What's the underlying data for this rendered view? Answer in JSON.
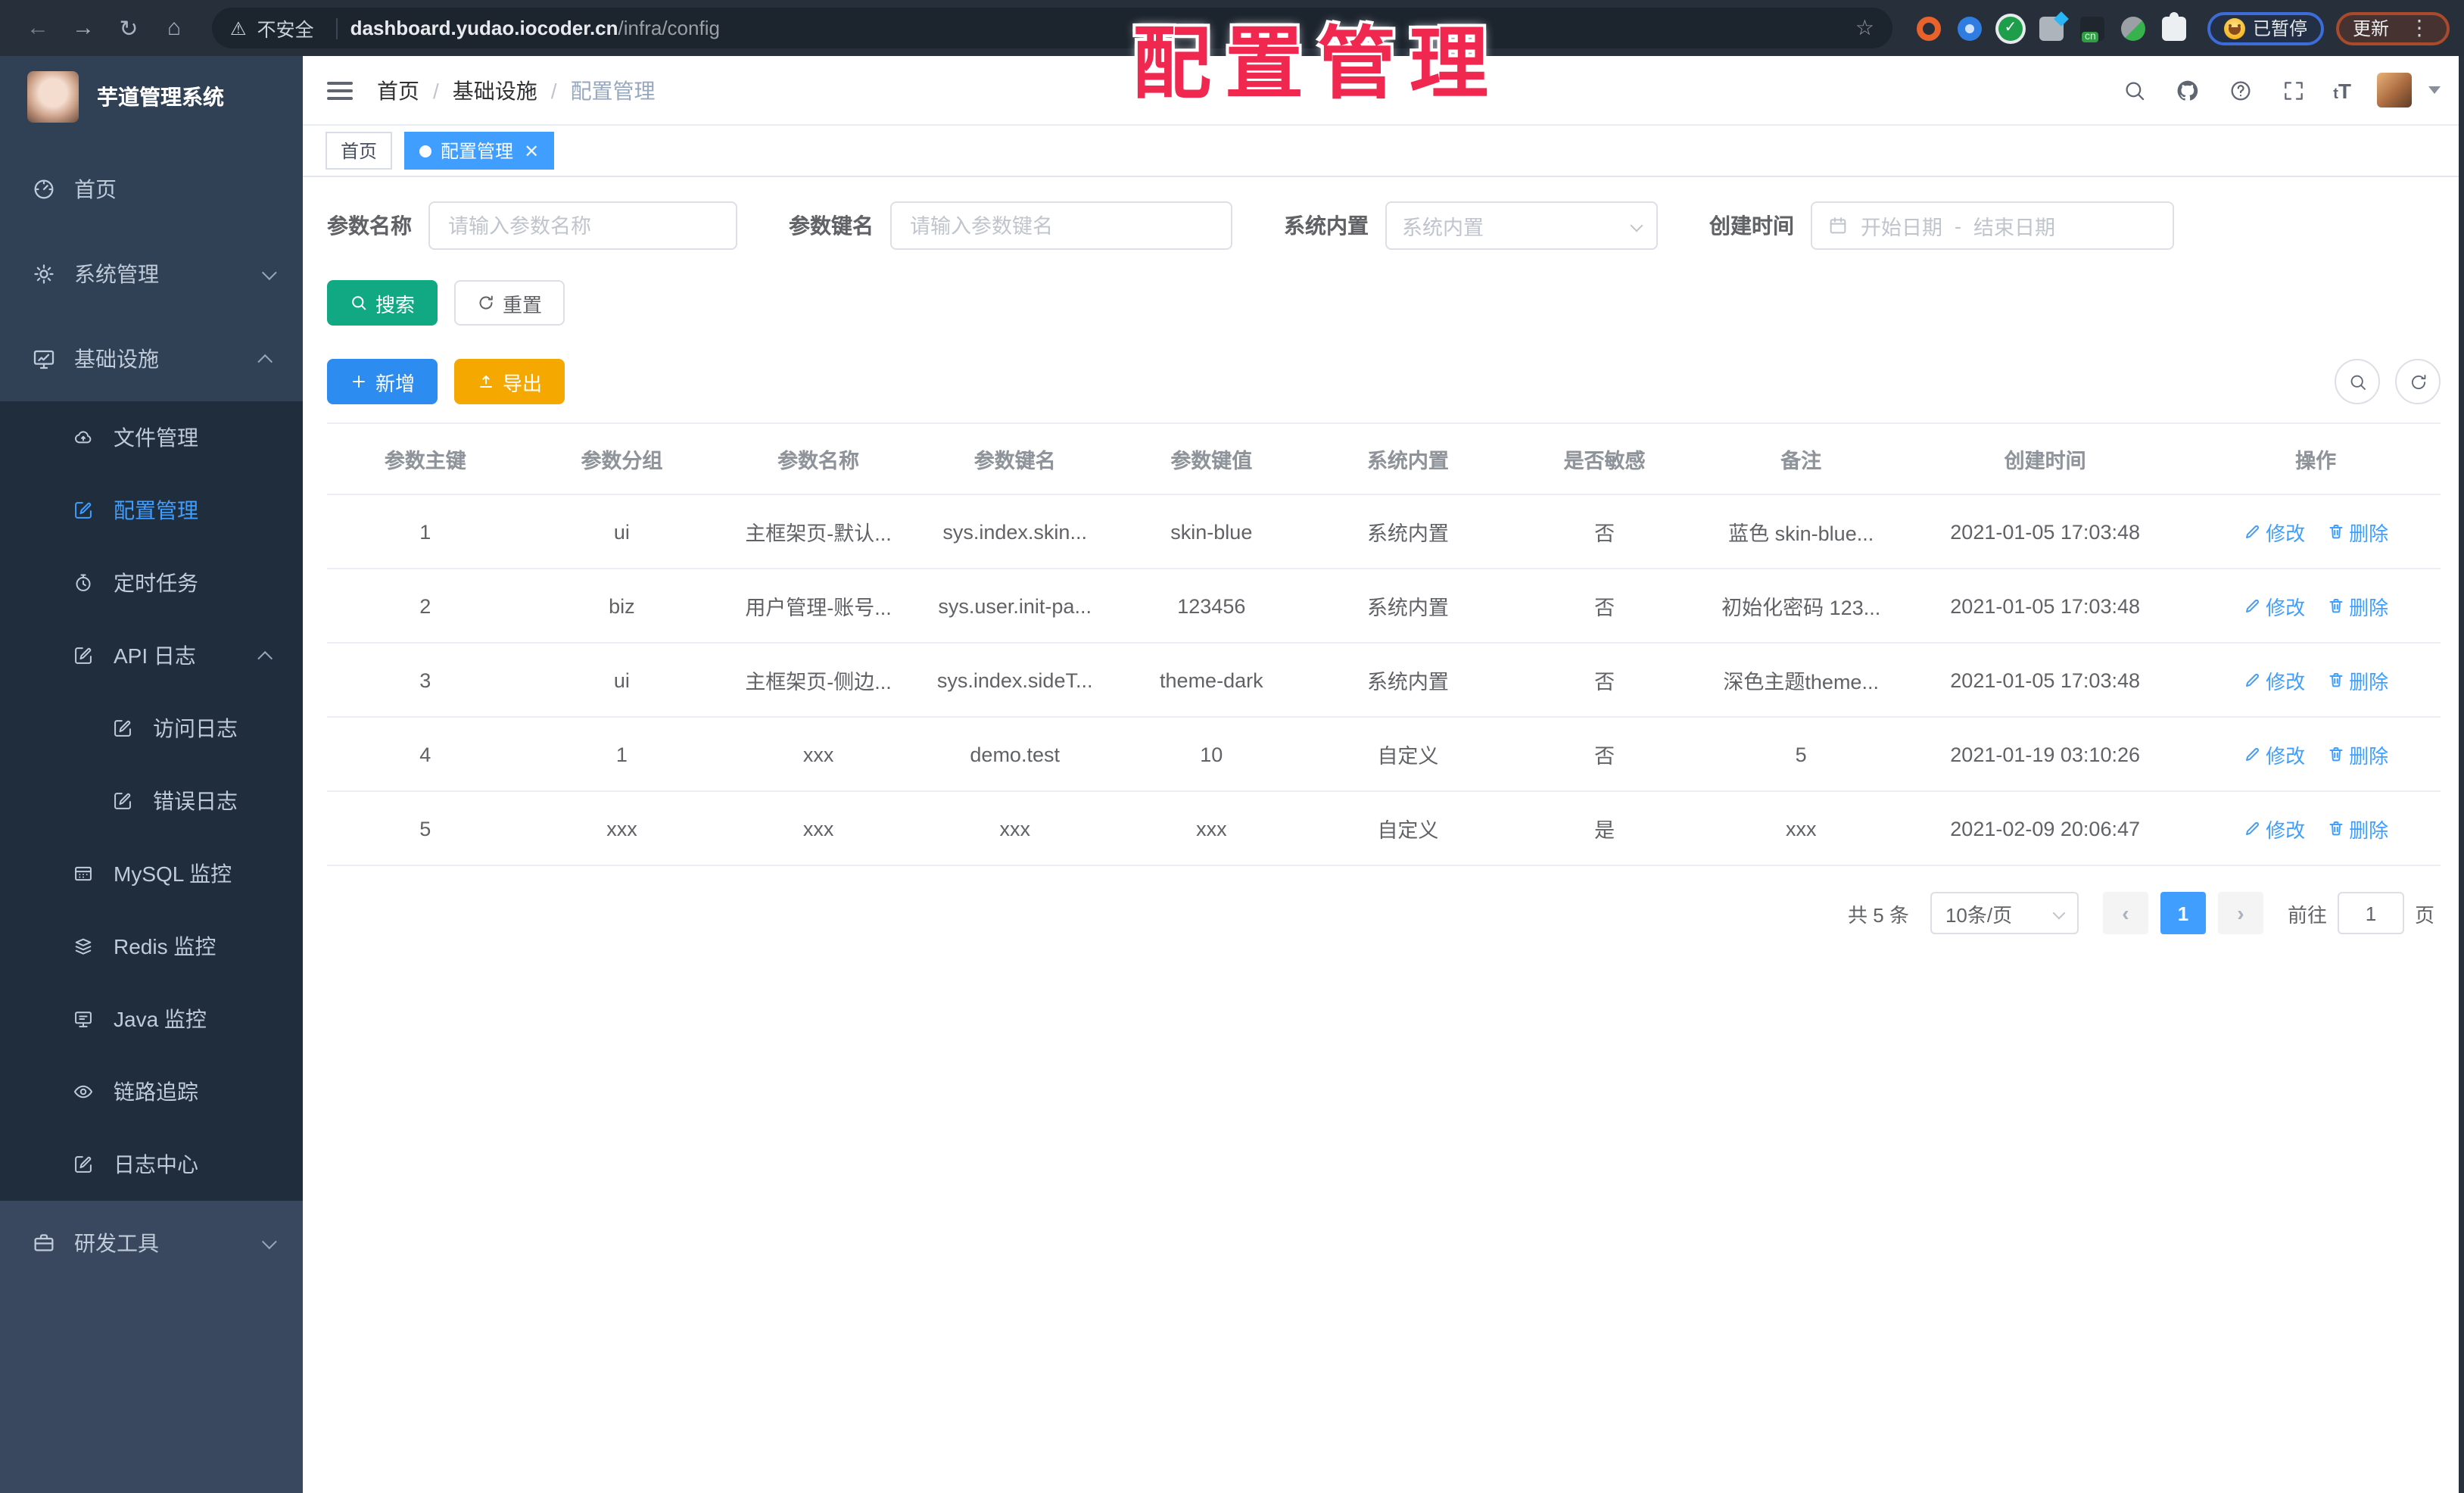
{
  "browser": {
    "security_label": "不安全",
    "url_host": "dashboard.yudao.iocoder.cn",
    "url_path": "/infra/config",
    "paused_chip_label": "已暂停",
    "update_chip_label": "更新"
  },
  "overlay_title": "配置管理",
  "sidebar": {
    "title": "芋道管理系统",
    "menu": [
      {
        "id": "home",
        "icon": "gauge",
        "label": "首页"
      },
      {
        "id": "system-management",
        "icon": "gear",
        "label": "系统管理",
        "chevron": "down"
      },
      {
        "id": "infrastructure",
        "icon": "monitor",
        "label": "基础设施",
        "chevron": "up",
        "children": [
          {
            "id": "file-management",
            "icon": "cloud",
            "label": "文件管理"
          },
          {
            "id": "config-management",
            "icon": "edit",
            "label": "配置管理",
            "active": true
          },
          {
            "id": "scheduled-tasks",
            "icon": "timer",
            "label": "定时任务"
          },
          {
            "id": "api-logs",
            "icon": "edit",
            "label": "API 日志",
            "chevron": "up"
          },
          {
            "id": "access-logs",
            "icon": "edit",
            "label": "访问日志",
            "level": 2
          },
          {
            "id": "error-logs",
            "icon": "edit",
            "label": "错误日志",
            "level": 2
          },
          {
            "id": "mysql-monitor",
            "icon": "db",
            "label": "MySQL 监控"
          },
          {
            "id": "redis-monitor",
            "icon": "stack",
            "label": "Redis 监控"
          },
          {
            "id": "java-monitor",
            "icon": "screen",
            "label": "Java 监控"
          },
          {
            "id": "tracing",
            "icon": "eye",
            "label": "链路追踪"
          },
          {
            "id": "log-center",
            "icon": "edit",
            "label": "日志中心"
          }
        ]
      },
      {
        "id": "dev-tools",
        "icon": "toolbox",
        "label": "研发工具",
        "chevron": "down",
        "section": "alt"
      }
    ]
  },
  "header": {
    "breadcrumb": [
      "首页",
      "基础设施",
      "配置管理"
    ],
    "breadcrumb_separator": "/"
  },
  "tags": [
    {
      "label": "首页",
      "active": false
    },
    {
      "label": "配置管理",
      "active": true,
      "closable": true
    }
  ],
  "filters": {
    "name_label": "参数名称",
    "name_placeholder": "请输入参数名称",
    "key_label": "参数键名",
    "key_placeholder": "请输入参数键名",
    "builtin_label": "系统内置",
    "builtin_placeholder": "系统内置",
    "date_label": "创建时间",
    "date_start_placeholder": "开始日期",
    "date_range_separator": "-",
    "date_end_placeholder": "结束日期",
    "search_label": "搜索",
    "reset_label": "重置",
    "add_label": "新增",
    "export_label": "导出"
  },
  "table": {
    "headers": [
      "参数主键",
      "参数分组",
      "参数名称",
      "参数键名",
      "参数键值",
      "系统内置",
      "是否敏感",
      "备注",
      "创建时间",
      "操作"
    ],
    "rows": [
      [
        "1",
        "ui",
        "主框架页-默认...",
        "sys.index.skin...",
        "skin-blue",
        "系统内置",
        "否",
        "蓝色 skin-blue...",
        "2021-01-05 17:03:48"
      ],
      [
        "2",
        "biz",
        "用户管理-账号...",
        "sys.user.init-pa...",
        "123456",
        "系统内置",
        "否",
        "初始化密码 123...",
        "2021-01-05 17:03:48"
      ],
      [
        "3",
        "ui",
        "主框架页-侧边...",
        "sys.index.sideT...",
        "theme-dark",
        "系统内置",
        "否",
        "深色主题theme...",
        "2021-01-05 17:03:48"
      ],
      [
        "4",
        "1",
        "xxx",
        "demo.test",
        "10",
        "自定义",
        "否",
        "5",
        "2021-01-19 03:10:26"
      ],
      [
        "5",
        "xxx",
        "xxx",
        "xxx",
        "xxx",
        "自定义",
        "是",
        "xxx",
        "2021-02-09 20:06:47"
      ]
    ],
    "edit_label": "修改",
    "delete_label": "删除"
  },
  "pagination": {
    "total": "共 5 条",
    "page_size": "10条/页",
    "current_page": "1",
    "goto_label": "前往",
    "goto_value": "1",
    "page_unit_label": "页"
  },
  "colors": {
    "accent": "#409EFF",
    "search_button": "#11A983",
    "add_button": "#2D8CF0",
    "export_button": "#F5A800",
    "overlay_text": "#F02850",
    "sidebar_bg": "#304156",
    "submenu_bg": "#1F2D3D"
  }
}
